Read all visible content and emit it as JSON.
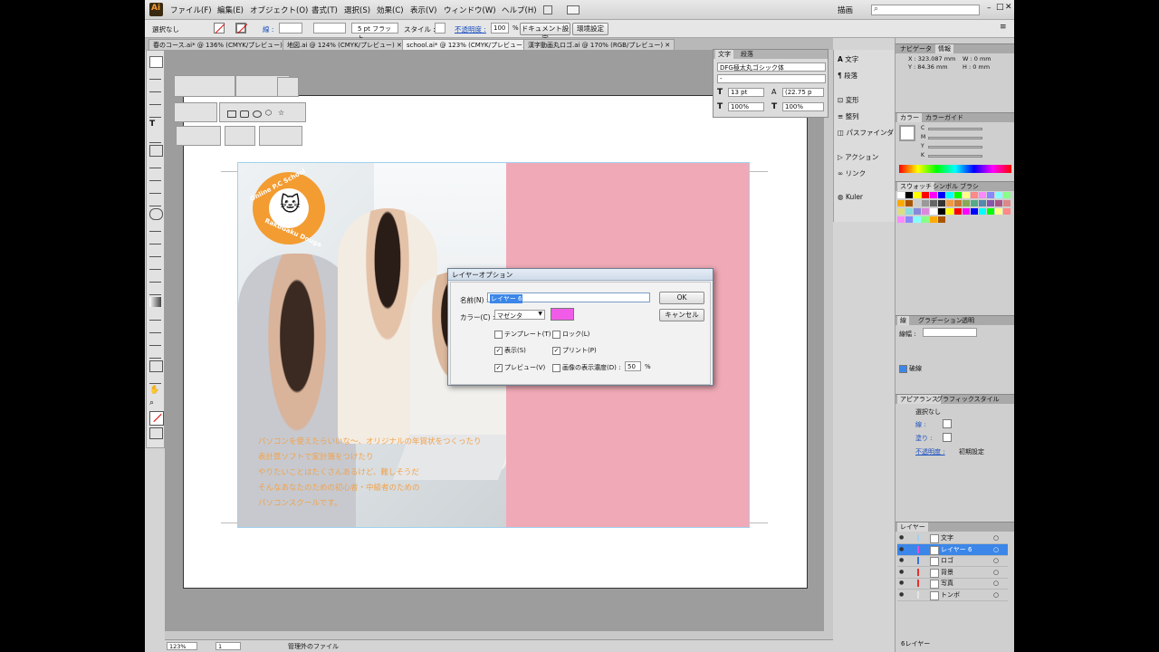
{
  "menubar": {
    "app_logo": "Ai",
    "items": [
      "ファイル(F)",
      "編集(E)",
      "オブジェクト(O)",
      "書式(T)",
      "選択(S)",
      "効果(C)",
      "表示(V)",
      "ウィンドウ(W)",
      "ヘルプ(H)"
    ],
    "workspace": "描画",
    "search_placeholder": ""
  },
  "control_bar": {
    "selection": "選択なし",
    "stroke_label": "線 :",
    "stroke_weight": "5 pt フラット",
    "style_label": "スタイル :",
    "opacity_label": "不透明度 :",
    "opacity_value": "100",
    "opacity_unit": "%",
    "document_setup": "ドキュメント設定",
    "preferences": "環境設定"
  },
  "doc_tabs": [
    {
      "label": "春のコース.ai* @ 136% (CMYK/プレビュー)",
      "active": false
    },
    {
      "label": "地図.ai @ 124% (CMYK/プレビュー)",
      "active": false
    },
    {
      "label": "school.ai* @ 123% (CMYK/プレビュー)",
      "active": true
    },
    {
      "label": "漢字動画丸ロゴ.ai @ 170% (RGB/プレビュー)",
      "active": false
    }
  ],
  "artwork": {
    "logo_top": "Online P.C School",
    "logo_bottom": "RakuGaku Douga",
    "copy_lines": [
      "パソコンを使えたらいいな〜、オリジナルの年賀状をつくったり",
      "表計算ソフトで家計簿をつけたり",
      "やりたいことはたくさんあるけど、難しそうだ",
      "そんなあなたのための初心者・中級者のための",
      "パソコンスクールです。"
    ]
  },
  "char_panel": {
    "tabs": [
      "文字",
      "段落"
    ],
    "font_family": "DFG極太丸ゴシック体",
    "font_style": "-",
    "font_size": "13 pt",
    "leading": "(22.75 p",
    "h_scale": "100%",
    "v_scale": "100%"
  },
  "dock": {
    "items": [
      "文字",
      "段落",
      "変形",
      "整列",
      "パスファインダ",
      "アクション",
      "リンク",
      "Kuler"
    ]
  },
  "info_panel": {
    "tabs": [
      "ナビゲータ",
      "情報"
    ],
    "x": "X : 323.087 mm",
    "y": "Y : 84.36 mm",
    "w": "W : 0 mm",
    "h": "H : 0 mm"
  },
  "color_panel": {
    "tabs": [
      "カラー",
      "カラーガイド"
    ],
    "channels": [
      "C",
      "M",
      "Y",
      "K"
    ],
    "unit": "%"
  },
  "swatch_panel": {
    "tabs": [
      "スウォッチ",
      "シンボル",
      "ブラシ"
    ]
  },
  "stroke_panel": {
    "tabs": [
      "線",
      "グラデーション",
      "透明"
    ],
    "weight_label": "線幅 :",
    "dash_label": "破線"
  },
  "appearance_panel": {
    "tabs": [
      "アピアランス",
      "グラフィックスタイル"
    ],
    "title": "選択なし",
    "stroke": "線 :",
    "fill": "塗り :",
    "opacity_label": "不透明度 :",
    "opacity_value": "初期設定"
  },
  "layers_panel": {
    "tab": "レイヤー",
    "layers": [
      {
        "name": "文字",
        "color": "#9fd2ef",
        "selected": false
      },
      {
        "name": "レイヤー 6",
        "color": "#e84fd6",
        "selected": true
      },
      {
        "name": "ロゴ",
        "color": "#3b72d9",
        "selected": false
      },
      {
        "name": "背景",
        "color": "#e23232",
        "selected": false
      },
      {
        "name": "写真",
        "color": "#e23232",
        "selected": false
      },
      {
        "name": "トンボ",
        "color": "#e5e5e5",
        "selected": false
      }
    ],
    "footer": "6レイヤー"
  },
  "dialog": {
    "title": "レイヤーオプション",
    "name_label": "名前(N) :",
    "name_value": "レイヤー 6",
    "color_label": "カラー(C) :",
    "color_value": "マゼンタ",
    "color_swatch": "#f05ce8",
    "ok": "OK",
    "cancel": "キャンセル",
    "options": [
      {
        "label": "テンプレート(T)",
        "checked": false
      },
      {
        "label": "ロック(L)",
        "checked": false
      },
      {
        "label": "表示(S)",
        "checked": true
      },
      {
        "label": "プリント(P)",
        "checked": true
      },
      {
        "label": "プレビュー(V)",
        "checked": true
      },
      {
        "label": "画像の表示濃度(D) :",
        "checked": false
      }
    ],
    "dim_value": "50",
    "dim_unit": "%"
  },
  "status_bar": {
    "zoom": "123%",
    "page": "1",
    "info": "管理外のファイル"
  },
  "colors": {
    "pink_panel": "#f0aab7",
    "copy_text": "#f2a24a",
    "logo_orange": "#f39c32",
    "selection_blue": "#3b86e8"
  }
}
